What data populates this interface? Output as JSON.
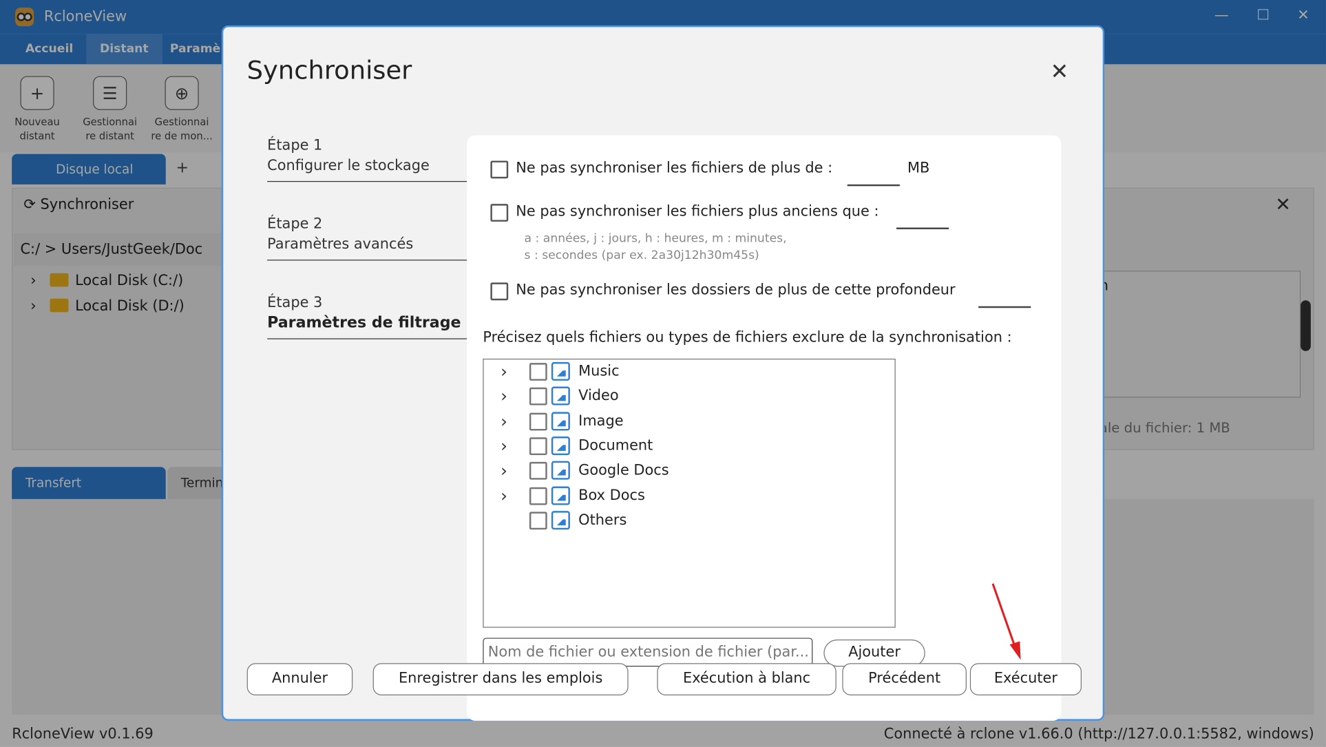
{
  "app": {
    "title": "RcloneView",
    "window_controls": [
      "—",
      "☐",
      "✕"
    ],
    "nav_tabs": [
      "Accueil",
      "Distant",
      "Paramè"
    ],
    "ribbon_buttons": [
      {
        "icon": "plus-icon",
        "line1": "Nouveau",
        "line2": "distant"
      },
      {
        "icon": "list-icon",
        "line1": "Gestionnai",
        "line2": "re distant"
      },
      {
        "icon": "mount-icon",
        "line1": "Gestionnai",
        "line2": "re de mon..."
      }
    ],
    "local_tab": "Disque local",
    "add_tab": "+",
    "sync_label": "Synchroniser",
    "path": {
      "root": "C:/",
      "sep": ">",
      "dir": "Users/JustGeek/Doc"
    },
    "drives": [
      "Local Disk (C:/)",
      "Local Disk (D:/)"
    ],
    "grid_header": "n",
    "status_right": "ale du fichier: 1 MB",
    "bottom_tabs": [
      "Transfert",
      "Termin"
    ],
    "status_left": "RcloneView v0.1.69",
    "status_connection": "Connecté à rclone v1.66.0 (http://127.0.0.1:5582, windows)"
  },
  "dialog": {
    "title": "Synchroniser",
    "close_glyph": "✕",
    "steps": [
      {
        "num": "Étape 1",
        "name": "Configurer le stockage",
        "active": false
      },
      {
        "num": "Étape 2",
        "name": "Paramètres avancés",
        "active": false
      },
      {
        "num": "Étape 3",
        "name": "Paramètres de filtrage",
        "active": true
      }
    ],
    "options": {
      "max_size_label": "Ne pas synchroniser les fichiers de plus de :",
      "max_size_unit": "MB",
      "max_age_label": "Ne pas synchroniser les fichiers plus anciens que :",
      "max_age_hint1": "a : années, j : jours, h : heures, m : minutes,",
      "max_age_hint2": "s : secondes (par ex. 2a30j12h30m45s)",
      "max_depth_label": "Ne pas synchroniser les dossiers de plus de cette profondeur"
    },
    "exclude_label": "Précisez quels fichiers ou types de fichiers exclure de la synchronisation :",
    "file_types": [
      {
        "label": "Music",
        "expandable": true,
        "checked": false
      },
      {
        "label": "Video",
        "expandable": true,
        "checked": false
      },
      {
        "label": "Image",
        "expandable": true,
        "checked": false
      },
      {
        "label": "Document",
        "expandable": true,
        "checked": false
      },
      {
        "label": "Google Docs",
        "expandable": true,
        "checked": false
      },
      {
        "label": "Box Docs",
        "expandable": true,
        "checked": false
      },
      {
        "label": "Others",
        "expandable": false,
        "checked": false
      }
    ],
    "name_input_placeholder": "Nom de fichier ou extension de fichier (par...",
    "add_button": "Ajouter",
    "buttons": {
      "cancel": "Annuler",
      "save_job": "Enregistrer dans les emplois",
      "dry_run": "Exécution à blanc",
      "previous": "Précédent",
      "run": "Exécuter"
    }
  },
  "colors": {
    "accent": "#2f7fd2",
    "annotation_arrow": "#e02020"
  }
}
